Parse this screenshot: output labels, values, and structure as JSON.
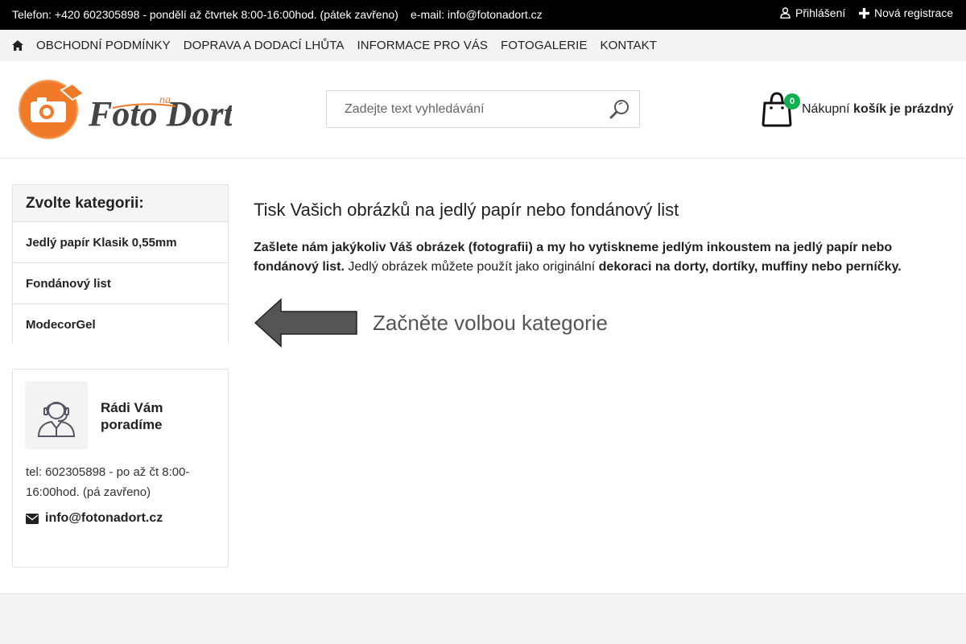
{
  "topbar": {
    "phone_text": "Telefon: +420 602305898 - pondělí až čtvrtek 8:00-16:00hod. (pátek zavřeno)",
    "email_text": "e-mail: info@fotonadort.cz",
    "login_label": "Přihlášení",
    "register_label": "Nová registrace"
  },
  "nav": {
    "items": [
      {
        "label": "OBCHODNÍ PODMÍNKY"
      },
      {
        "label": "DOPRAVA A DODACÍ LHŮTA"
      },
      {
        "label": "INFORMACE PRO VÁS"
      },
      {
        "label": "FOTOGALERIE"
      },
      {
        "label": "KONTAKT"
      }
    ]
  },
  "header": {
    "logo_small": "na",
    "logo_text": "Foto Dort",
    "search_placeholder": "Zadejte text vyhledávání",
    "cart_count": "0",
    "cart_prefix": "Nákupní",
    "cart_status": "košík je prázdný"
  },
  "sidebar": {
    "heading": "Zvolte kategorii:",
    "categories": [
      {
        "label": "Jedlý papír Klasik 0,55mm"
      },
      {
        "label": "Fondánový list"
      },
      {
        "label": "ModecorGel"
      }
    ]
  },
  "help": {
    "title": "Rádi Vám poradíme",
    "phone": "tel: 602305898 - po až čt 8:00-16:00hod. (pá zavřeno)",
    "email": "info@fotonadort.cz"
  },
  "main": {
    "title": "Tisk Vašich obrázků na jedlý papír nebo fondánový list",
    "intro_bold1": "Zašlete nám jakýkoliv Váš obrázek (fotografii) a my ho vytiskneme jedlým inkoustem na jedlý papír nebo fondánový list.",
    "intro_text": " Jedlý obrázek můžete použít jako originální ",
    "intro_bold2": "dekoraci na dorty, dortíky, muffiny nebo perníčky.",
    "banner_text": "Začněte volbou kategorie"
  },
  "colors": {
    "topbar_bg": "#000000",
    "badge_green": "#10b050",
    "logo_orange": "#f07a2a"
  }
}
